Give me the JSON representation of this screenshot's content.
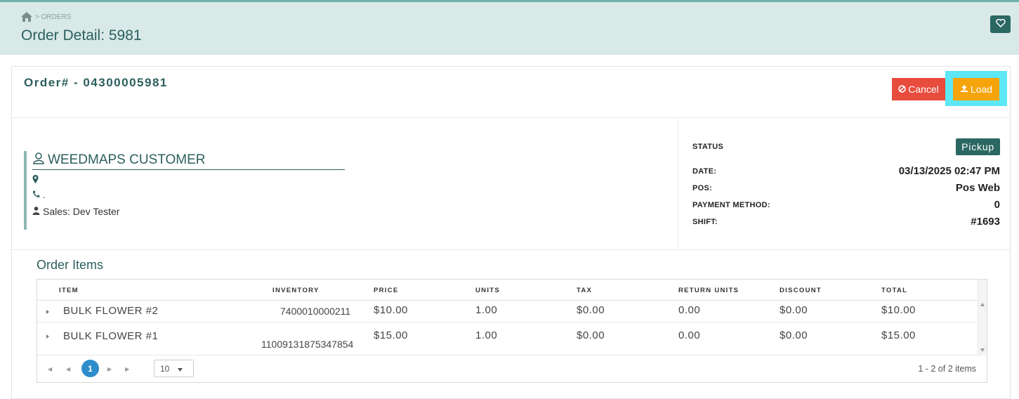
{
  "header": {
    "breadcrumb": "> ORDERS",
    "title": "Order Detail: 5981"
  },
  "order": {
    "number_label": "Order# - 04300005981",
    "cancel_label": "Cancel",
    "load_label": "Load"
  },
  "customer": {
    "name": "WEEDMAPS CUSTOMER",
    "address": "",
    "phone": ".",
    "sales": "Sales: Dev Tester"
  },
  "status": {
    "status_label": "STATUS",
    "status_value": "Pickup",
    "date_label": "DATE:",
    "date_value": "03/13/2025 02:47 PM",
    "pos_label": "POS:",
    "pos_value": "Pos Web",
    "payment_label": "PAYMENT METHOD:",
    "payment_value": "0",
    "shift_label": "SHIFT:",
    "shift_value": "#1693"
  },
  "items": {
    "title": "Order Items",
    "columns": [
      "ITEM",
      "INVENTORY",
      "PRICE",
      "UNITS",
      "TAX",
      "RETURN UNITS",
      "DISCOUNT",
      "TOTAL"
    ],
    "rows": [
      {
        "item": "BULK FLOWER #2",
        "inventory": "7400010000211",
        "price": "$10.00",
        "units": "1.00",
        "tax": "$0.00",
        "return_units": "0.00",
        "discount": "$0.00",
        "total": "$10.00"
      },
      {
        "item": "BULK FLOWER #1",
        "inventory": "11009131875347854",
        "price": "$15.00",
        "units": "1.00",
        "tax": "$0.00",
        "return_units": "0.00",
        "discount": "$0.00",
        "total": "$15.00"
      }
    ],
    "pager": {
      "current_page": "1",
      "page_size": "10",
      "info": "1 - 2 of 2 items"
    }
  },
  "colors": {
    "accent": "#2b6763",
    "header_bg": "#d8e9e8",
    "cancel": "#e84c3d",
    "load": "#f5a40c",
    "highlight": "#5ee7f5",
    "link": "#28b0a0",
    "pager_active": "#2d8dcc"
  },
  "icons": {
    "home": "home-icon",
    "favorite": "heart-icon",
    "cancel": "ban-icon",
    "load": "upload-icon",
    "customer": "user-outline-icon",
    "address": "map-marker-icon",
    "phone": "phone-icon",
    "sales": "user-icon"
  }
}
